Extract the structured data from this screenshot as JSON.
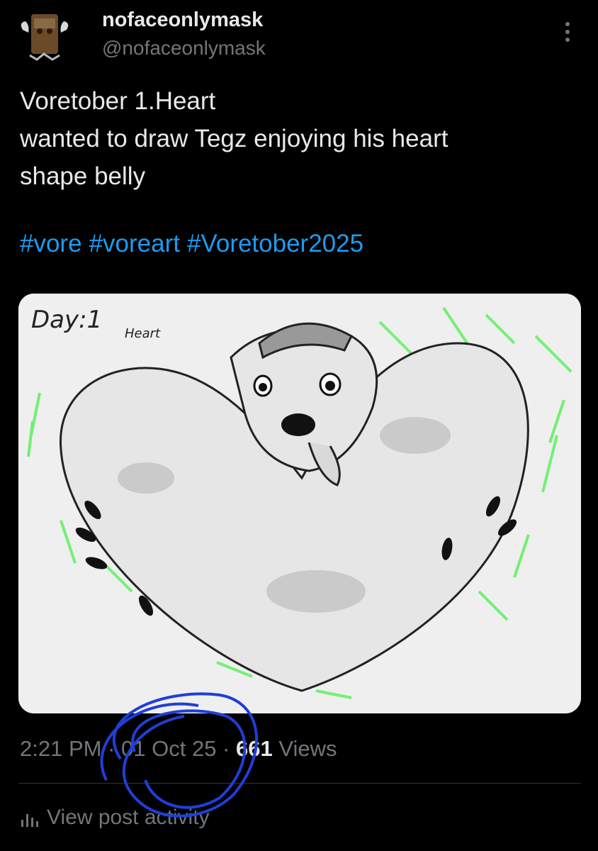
{
  "author": {
    "display_name": "nofaceonlymask",
    "handle": "@nofaceonlymask"
  },
  "tweet": {
    "lines": [
      "Voretober 1.Heart",
      "wanted to draw Tegz enjoying his heart",
      "shape belly"
    ],
    "hashtags": [
      "#vore",
      "#voreart",
      "#Voretober2025"
    ]
  },
  "media": {
    "handwritten_title": "Day:1",
    "handwritten_subtitle": "Heart"
  },
  "meta": {
    "time": "2:21 PM",
    "separator1": " · ",
    "date": "01 Oct 25",
    "separator2": " · ",
    "views_count": "661",
    "views_label": " Views"
  },
  "actions": {
    "view_activity": "View post activity"
  },
  "colors": {
    "background": "#000000",
    "text": "#e7e9ea",
    "muted": "#71767b",
    "link": "#1d9bf0",
    "scribble": "#1f3fd6",
    "sparkle": "#5ef05e"
  },
  "icons": {
    "more": "more-vertical-icon",
    "activity": "bar-chart-icon"
  }
}
